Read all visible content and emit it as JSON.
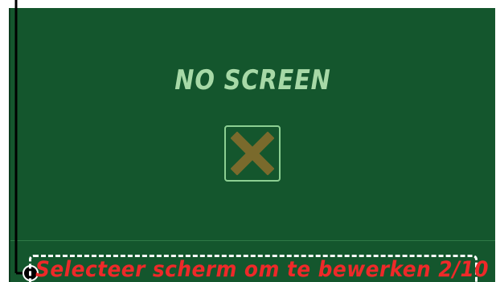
{
  "screen": {
    "title": "NO SCREEN",
    "placeholder_icon": "close-icon"
  },
  "caption": {
    "text": "Selecteer scherm om te bewerken 2/10"
  },
  "colors": {
    "panel_background": "#14562d",
    "title": "#a7d9a7",
    "icon_border": "#8ccf92",
    "icon_x": "#7a6a2c",
    "caption_text": "#ee2929",
    "caption_border": "#ffffff",
    "connector": "#000000"
  }
}
